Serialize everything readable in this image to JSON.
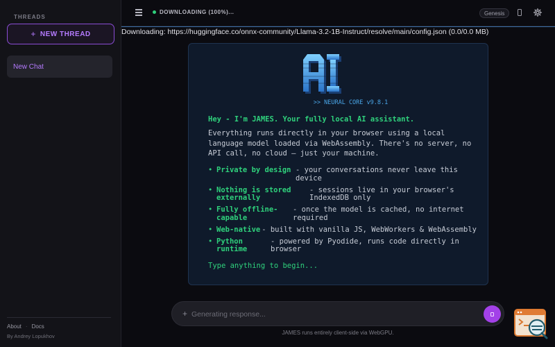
{
  "sidebar": {
    "threads_label": "THREADS",
    "new_thread_label": "NEW THREAD",
    "threads": [
      {
        "label": "New Chat",
        "active": true
      }
    ],
    "footer": {
      "links": [
        "About",
        "Docs"
      ],
      "author": "By Andrey Lopukhov"
    }
  },
  "topbar": {
    "status": "DOWNLOADING (100%)...",
    "model_badge": "Genesis",
    "icons": [
      "menu-icon",
      "phone-icon",
      "gear-icon"
    ]
  },
  "download": {
    "text": "Downloading: https://huggingface.co/onnx-community/Llama-3.2-1B-Instruct/resolve/main/config.json (0.0/0.0 MB)"
  },
  "welcome": {
    "logo_text": "AI",
    "version": ">> NEURAL CORE v9.8.1",
    "greeting": "Hey - I'm JAMES. Your fully local AI assistant.",
    "intro": "Everything runs directly in your browser using a local language model loaded via WebAssembly. There's no server, no API call, no cloud — just your machine.",
    "features": [
      {
        "title": "Private by design",
        "desc": "- your conversations never leave this device"
      },
      {
        "title": "Nothing is stored externally",
        "desc": "- sessions live in your browser's IndexedDB only"
      },
      {
        "title": "Fully offline-capable",
        "desc": "- once the model is cached, no internet required"
      },
      {
        "title": "Web-native",
        "desc": "- built with vanilla JS, WebWorkers & WebAssembly"
      },
      {
        "title": "Python runtime",
        "desc": "- powered by Pyodide, runs code directly in browser"
      }
    ],
    "prompt_hint": "Type anything to begin..."
  },
  "composer": {
    "placeholder": "Generating response...",
    "value": "",
    "disclaimer": "JAMES runs entirely client-side via WebGPU."
  },
  "colors": {
    "accent_purple": "#a341e8",
    "accent_green": "#2fd17c",
    "accent_blue": "#4aa6e8"
  }
}
